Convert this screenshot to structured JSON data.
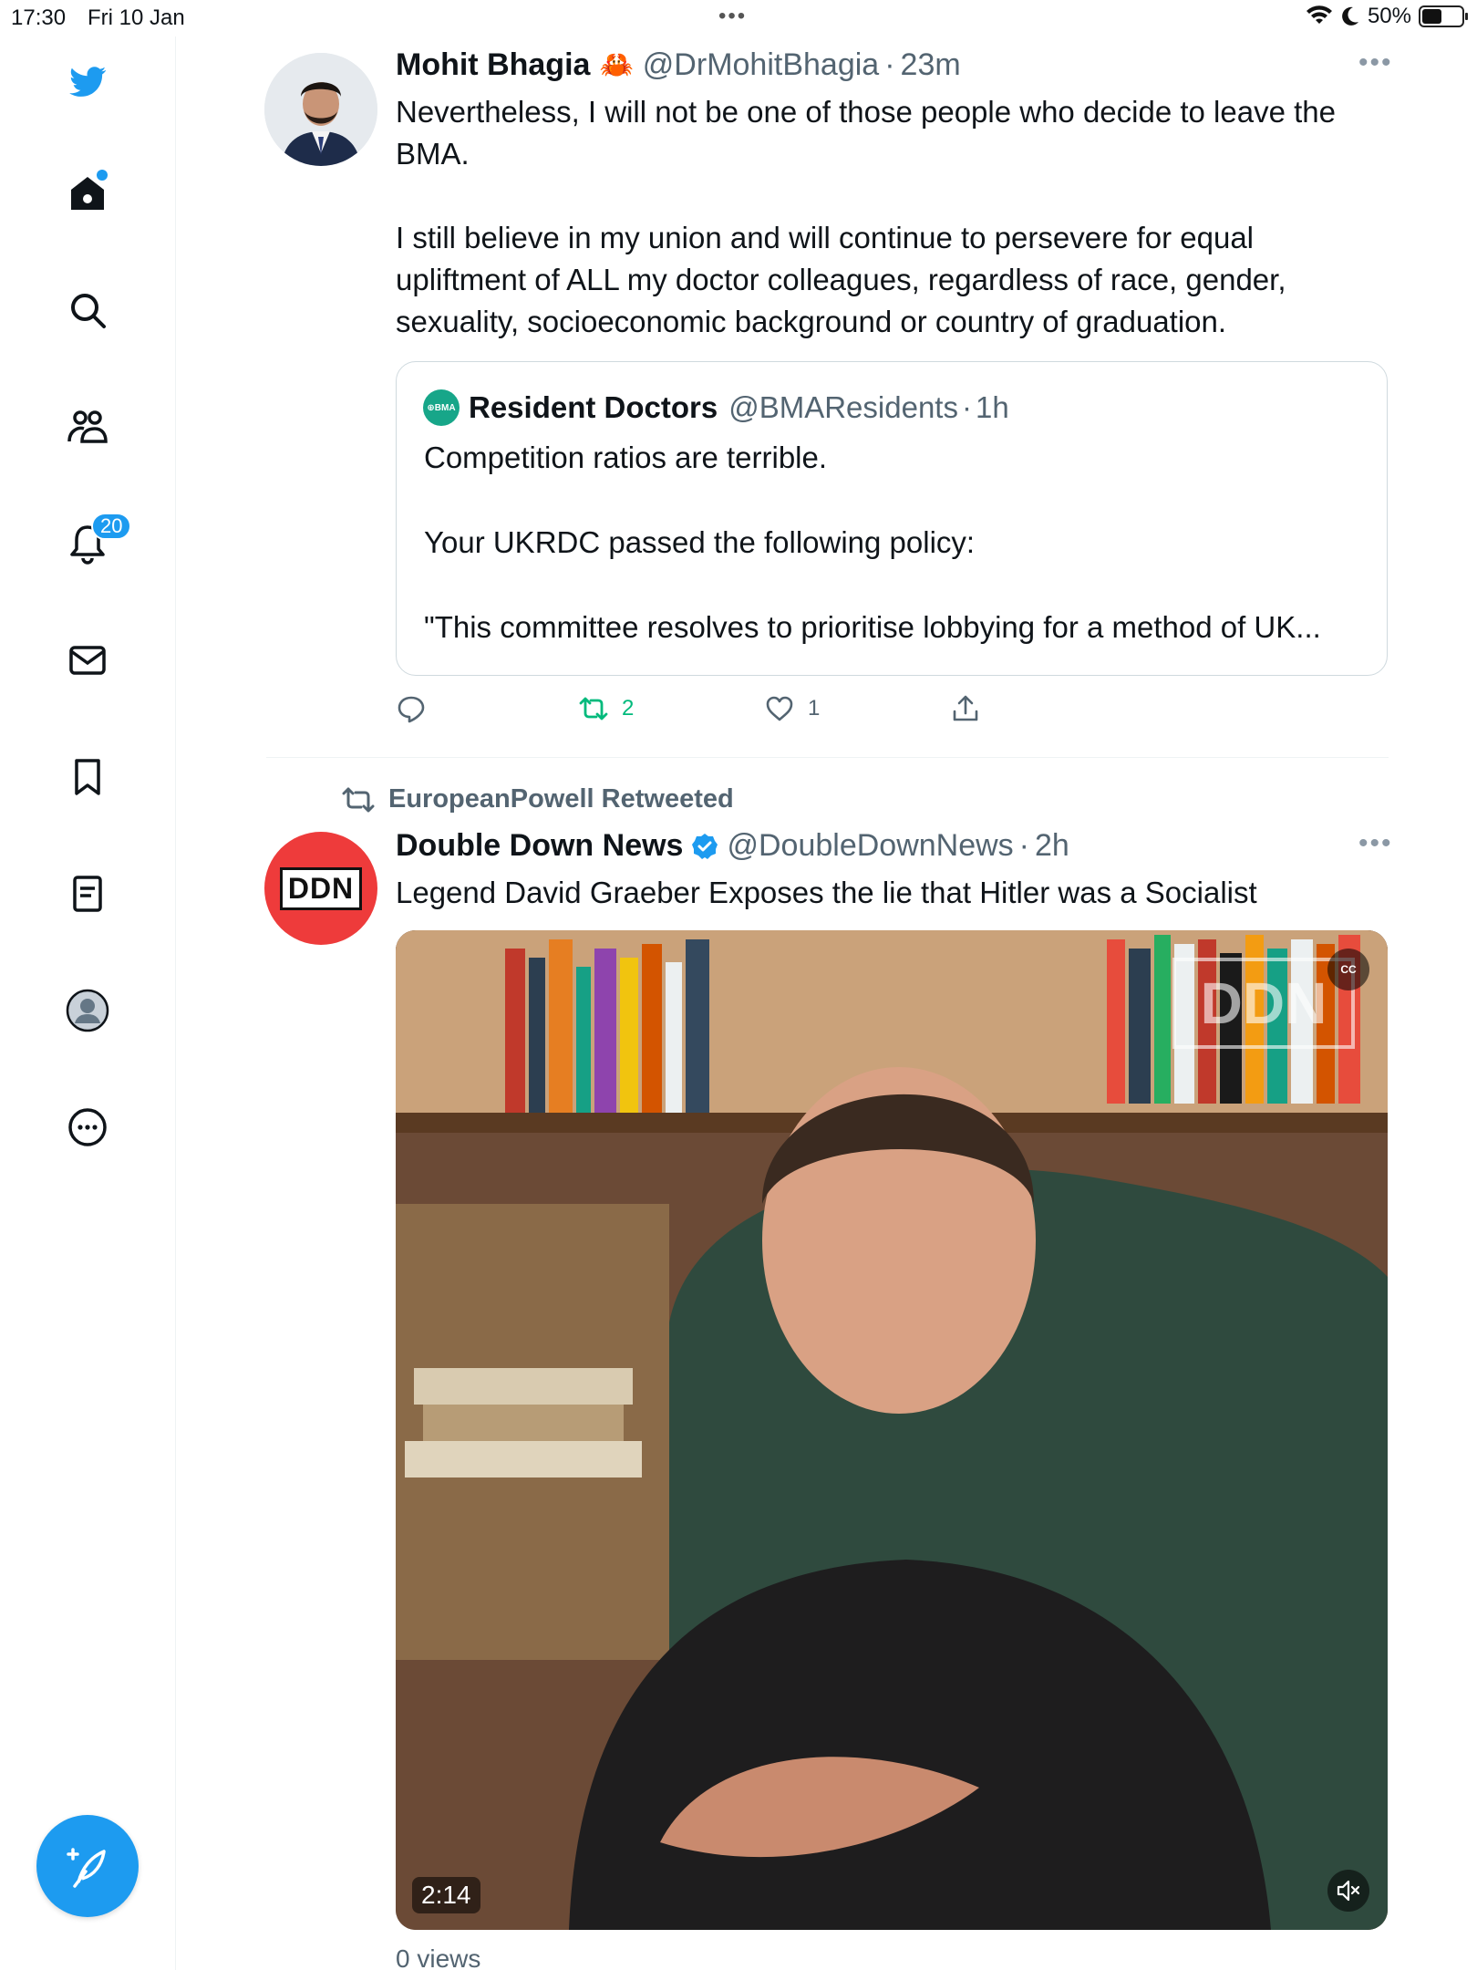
{
  "status_bar": {
    "time": "17:30",
    "date": "Fri 10 Jan",
    "battery": "50%",
    "battery_level": 0.5
  },
  "sidebar": {
    "notifications_count": "20",
    "items": [
      {
        "name": "twitter-logo"
      },
      {
        "name": "home"
      },
      {
        "name": "explore"
      },
      {
        "name": "communities"
      },
      {
        "name": "notifications"
      },
      {
        "name": "messages"
      },
      {
        "name": "bookmarks"
      },
      {
        "name": "lists"
      },
      {
        "name": "profile"
      },
      {
        "name": "more"
      }
    ]
  },
  "colors": {
    "accent": "#1d9bf0",
    "retweet_green": "#00ba7c",
    "secondary_text": "#536471"
  },
  "tweet1": {
    "name": "Mohit Bhagia",
    "emoji": "🦀",
    "handle": "@DrMohitBhagia",
    "sep": "·",
    "time": "23m",
    "text": "Nevertheless, I will not be one of those people who decide to leave the BMA.\n\nI still believe in my union and will continue to persevere for equal upliftment of ALL my doctor colleagues, regardless of race, gender, sexuality, socioeconomic background or country of graduation.",
    "quote": {
      "avatar_label": "⊕BMA",
      "name": "Resident Doctors",
      "handle": "@BMAResidents",
      "sep": "·",
      "time": "1h",
      "text": "Competition ratios are terrible.\n\nYour UKRDC passed the following policy:\n\n\"This committee resolves to prioritise lobbying for a method of UK..."
    },
    "actions": {
      "reply_count": "",
      "retweet_count": "2",
      "like_count": "1"
    }
  },
  "tweet2": {
    "retweeted_by": "EuropeanPowell Retweeted",
    "avatar_label": "DDN",
    "name": "Double Down News",
    "handle": "@DoubleDownNews",
    "sep": "·",
    "time": "2h",
    "text": "Legend David Graeber Exposes the lie that Hitler was a Socialist",
    "video": {
      "duration": "2:14",
      "cc_label": "CC",
      "watermark": "DDN"
    },
    "views": "0 views"
  }
}
